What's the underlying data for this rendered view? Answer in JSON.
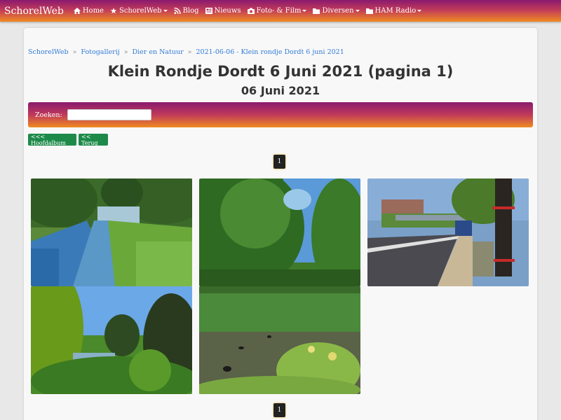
{
  "navbar": {
    "brand": "SchorelWeb",
    "items": [
      {
        "label": "Home",
        "icon": "home-icon",
        "dropdown": false
      },
      {
        "label": "SchorelWeb",
        "icon": "star-icon",
        "dropdown": true
      },
      {
        "label": "Blog",
        "icon": "rss-icon",
        "dropdown": false
      },
      {
        "label": "Nieuws",
        "icon": "newspaper-icon",
        "dropdown": false
      },
      {
        "label": "Foto- & Film",
        "icon": "camera-icon",
        "dropdown": true
      },
      {
        "label": "Diversen",
        "icon": "folder-icon",
        "dropdown": true
      },
      {
        "label": "HAM Radio",
        "icon": "folder-icon",
        "dropdown": true
      }
    ]
  },
  "breadcrumb": [
    "SchorelWeb",
    "Fotogallerij",
    "Dier en Natuur",
    "2021-06-06 - Klein rondje Dordt 6 juni 2021"
  ],
  "page": {
    "title": "Klein Rondje Dordt 6 Juni 2021 (pagina 1)",
    "subtitle": "06 Juni 2021"
  },
  "search": {
    "label": "Zoeken:",
    "value": ""
  },
  "buttons": {
    "main_album": "<<< Hoofdalbum",
    "back": "<< Terug"
  },
  "pagination": {
    "current": "1"
  },
  "colors": {
    "gradient_start": "#8a1a6e",
    "gradient_end": "#f08a20",
    "button_green": "#1e8a4a",
    "link_blue": "#2f7bd5"
  }
}
